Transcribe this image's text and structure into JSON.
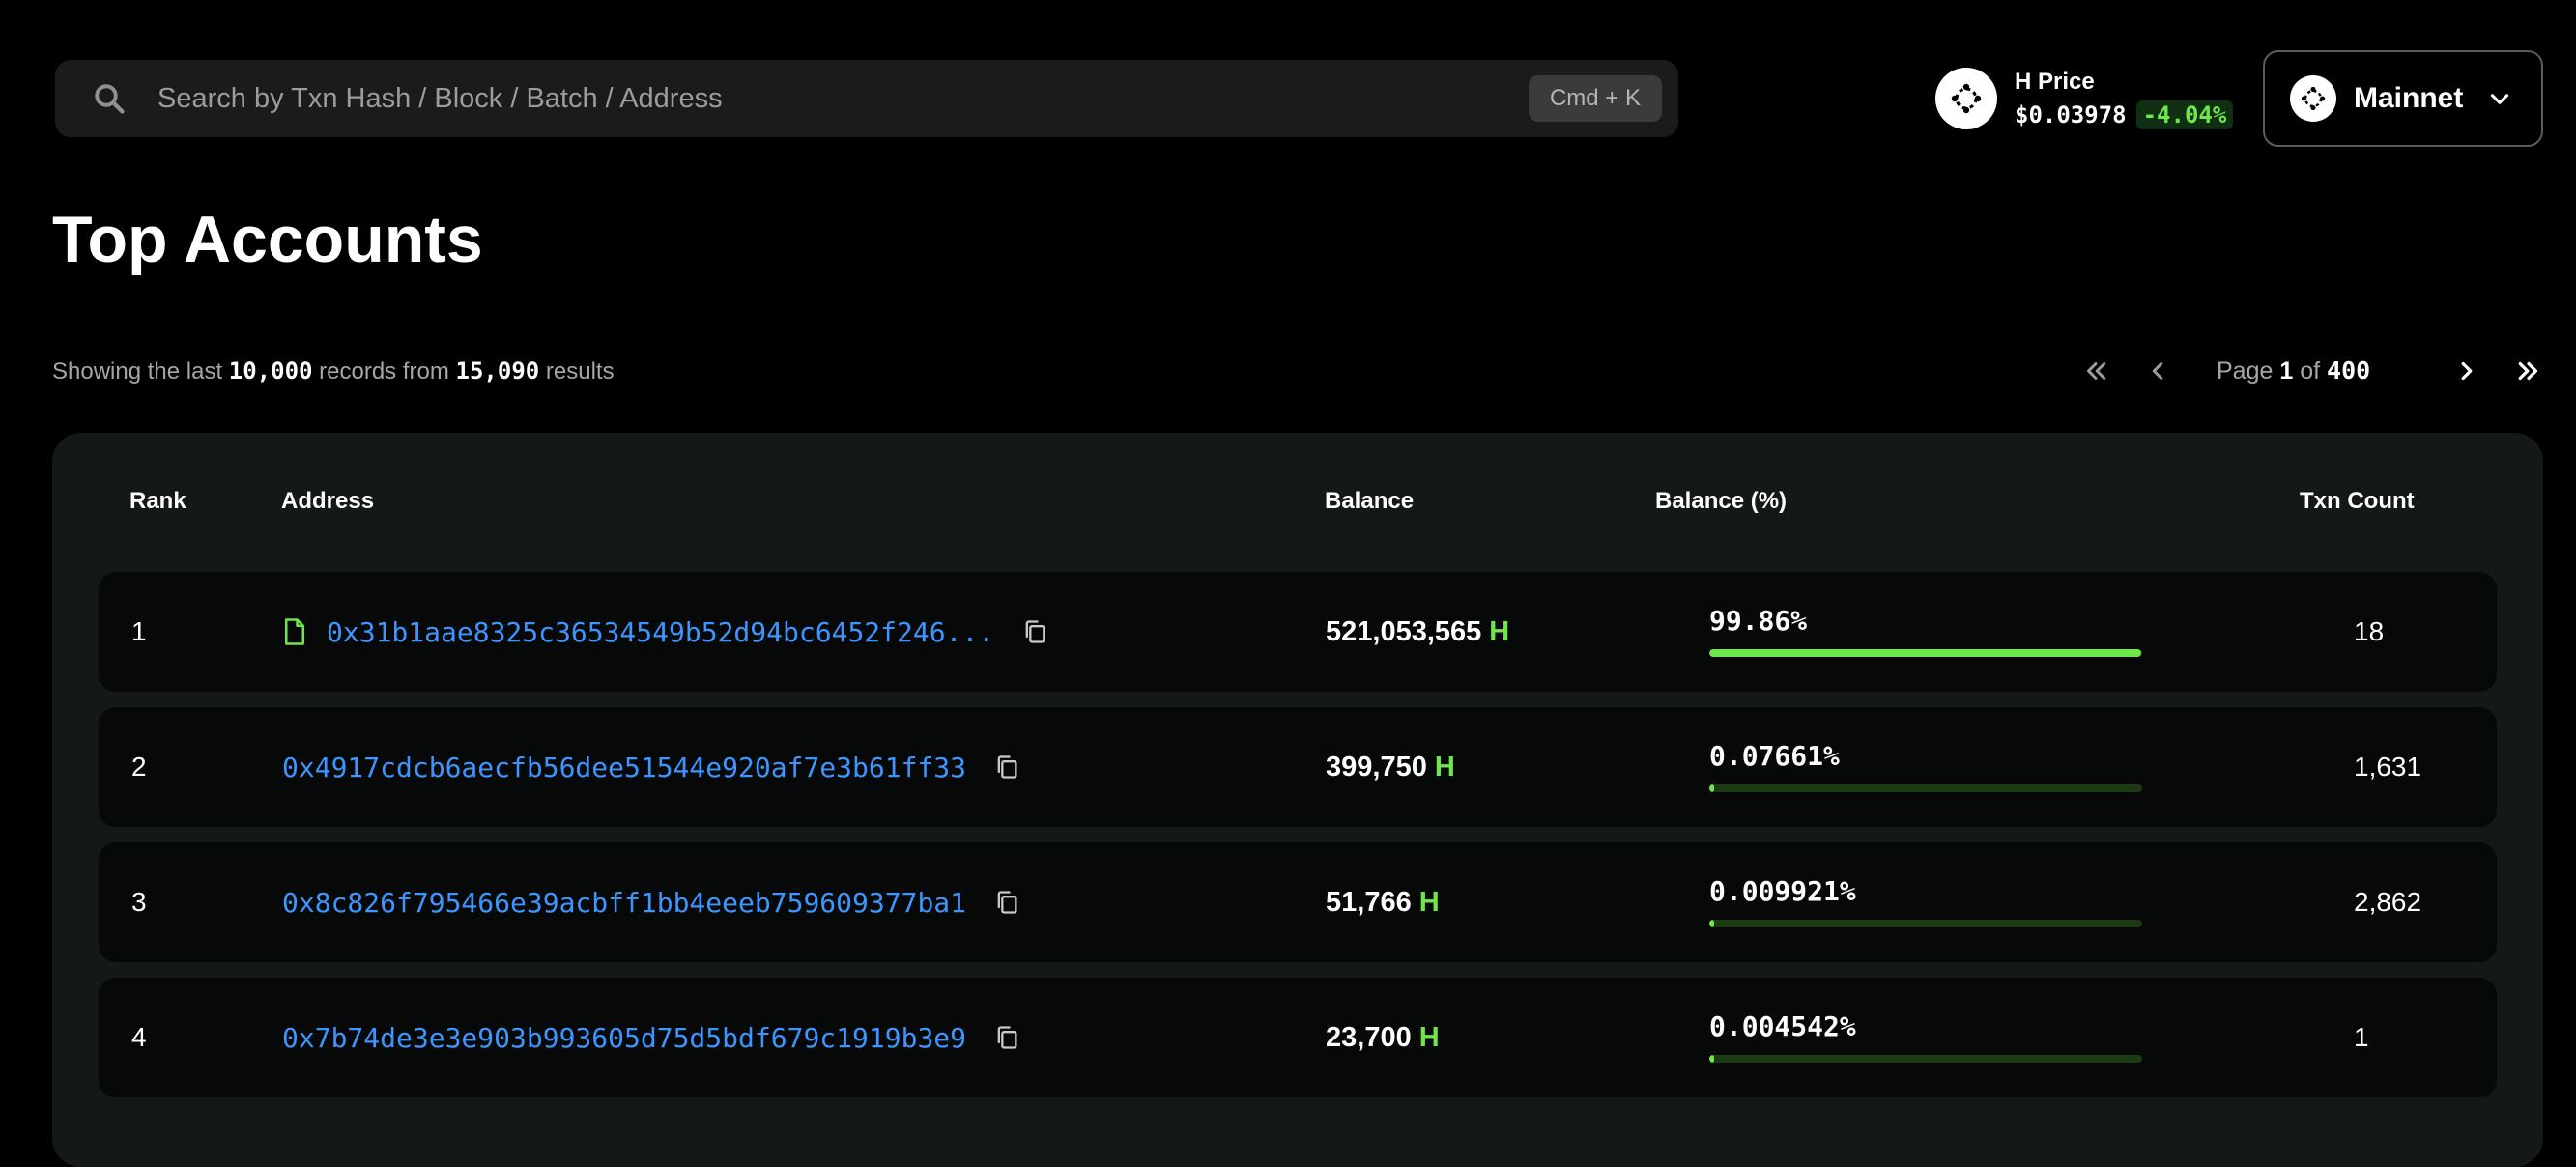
{
  "search": {
    "placeholder": "Search by Txn Hash / Block / Batch / Address",
    "shortcut": "Cmd + K"
  },
  "price": {
    "label": "H Price",
    "value": "$0.03978",
    "change": "-4.04%"
  },
  "network": {
    "name": "Mainnet"
  },
  "page_title": "Top Accounts",
  "summary": {
    "prefix": "Showing the last",
    "records": "10,000",
    "middle": "records from",
    "results": "15,090",
    "suffix": "results"
  },
  "pagination": {
    "page_label": "Page",
    "current": "1",
    "of_label": "of",
    "total": "400"
  },
  "table": {
    "headers": {
      "rank": "Rank",
      "address": "Address",
      "balance": "Balance",
      "balance_pct": "Balance (%)",
      "txn_count": "Txn Count"
    },
    "unit": "H",
    "rows": [
      {
        "rank": "1",
        "address": "0x31b1aae8325c36534549b52d94bc6452f246...",
        "is_contract": true,
        "balance": "521,053,565",
        "balance_pct": "99.86%",
        "pct_value": 99.86,
        "txn_count": "18"
      },
      {
        "rank": "2",
        "address": "0x4917cdcb6aecfb56dee51544e920af7e3b61ff33",
        "is_contract": false,
        "balance": "399,750",
        "balance_pct": "0.07661%",
        "pct_value": 0.07661,
        "txn_count": "1,631"
      },
      {
        "rank": "3",
        "address": "0x8c826f795466e39acbff1bb4eeeb759609377ba1",
        "is_contract": false,
        "balance": "51,766",
        "balance_pct": "0.009921%",
        "pct_value": 0.009921,
        "txn_count": "2,862"
      },
      {
        "rank": "4",
        "address": "0x7b74de3e3e903b993605d75d5bdf679c1919b3e9",
        "is_contract": false,
        "balance": "23,700",
        "balance_pct": "0.004542%",
        "pct_value": 0.004542,
        "txn_count": "1"
      }
    ]
  },
  "colors": {
    "background": "#000000",
    "accent_green": "#6ee64c",
    "link_blue": "#3d96ff",
    "panel": "#151818",
    "row": "#070808"
  },
  "icons": {
    "search": "search-icon",
    "copy": "copy-icon",
    "contract": "document-icon",
    "network": "chevron-down-icon",
    "pager": [
      "double-chevron-left-icon",
      "chevron-left-icon",
      "chevron-right-icon",
      "double-chevron-right-icon"
    ]
  }
}
